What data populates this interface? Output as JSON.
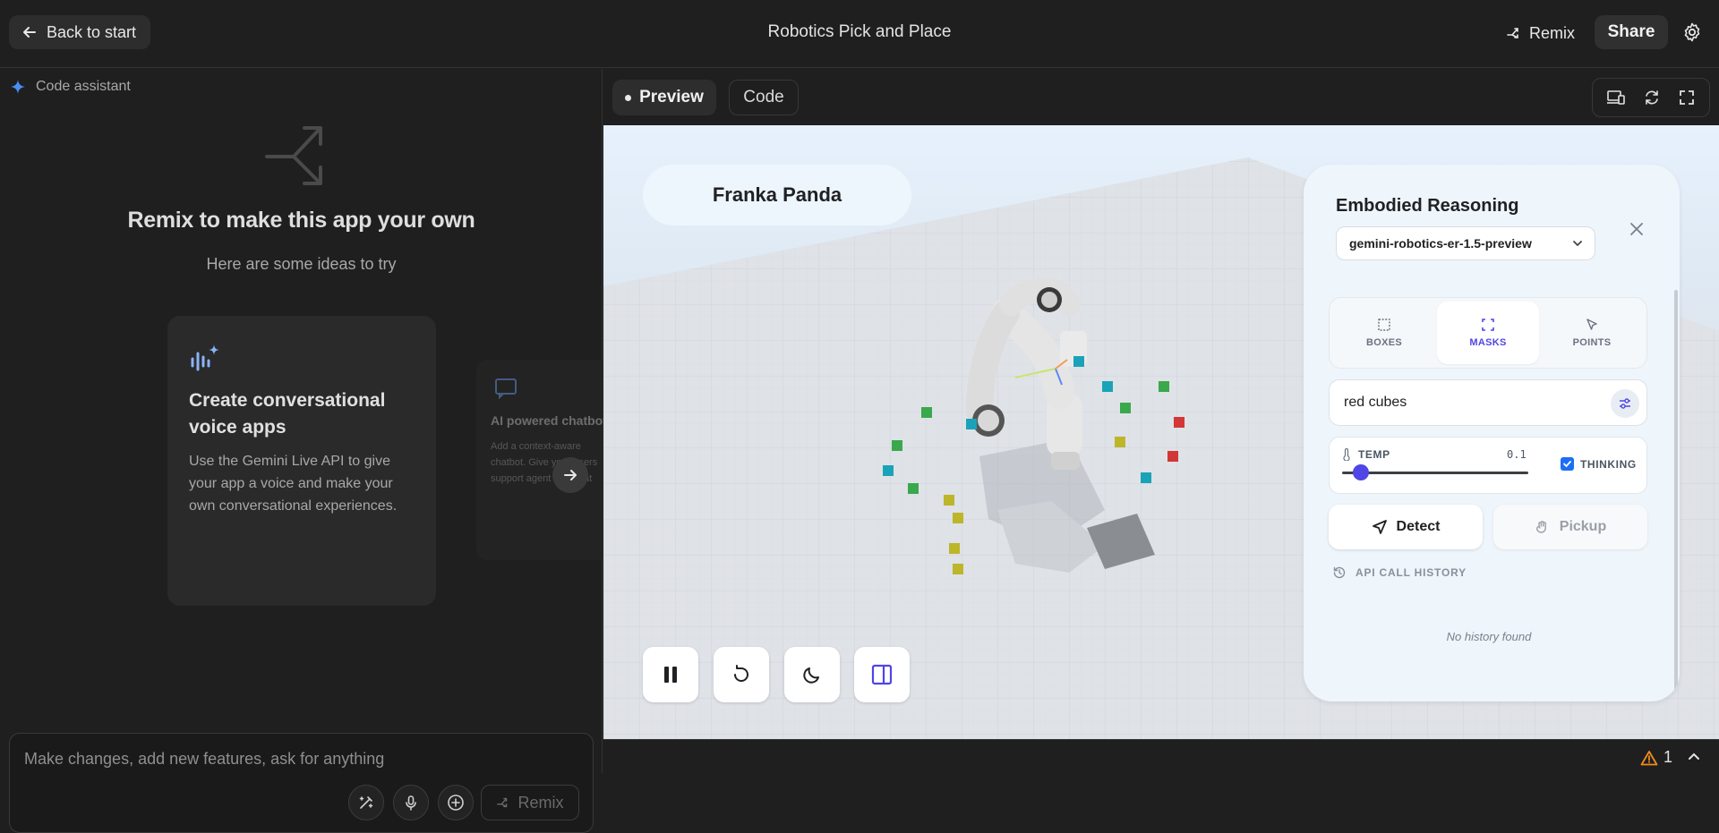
{
  "header": {
    "back_label": "Back to start",
    "app_title": "Robotics Pick and Place",
    "remix_label": "Remix",
    "share_label": "Share"
  },
  "left_panel": {
    "assistant_label": "Code assistant",
    "heading": "Remix to make this app your own",
    "subheading": "Here are some ideas to try",
    "cards": [
      {
        "title": "Create conversational voice apps",
        "description": "Use the Gemini Live API to give your app a voice and make your own conversational experiences."
      },
      {
        "title": "AI powered chatbot",
        "description": "Add a context-aware chatbot. Give your users support agent or a chat"
      }
    ],
    "prompt_placeholder": "Make changes, add new features, ask for anything",
    "remix_button_label": "Remix"
  },
  "tabs": {
    "preview_label": "Preview",
    "code_label": "Code"
  },
  "viewport": {
    "robot_name": "Franka Panda"
  },
  "er_panel": {
    "title": "Embodied Reasoning",
    "model": "gemini-robotics-er-1.5-preview",
    "modes": [
      {
        "label": "BOXES",
        "icon": "boxes-icon"
      },
      {
        "label": "MASKS",
        "icon": "masks-icon",
        "active": true
      },
      {
        "label": "POINTS",
        "icon": "points-icon"
      }
    ],
    "query_value": "red cubes",
    "temp_label": "TEMP",
    "temp_value": "0.1",
    "temp_fraction": 0.1,
    "thinking_label": "THINKING",
    "thinking_checked": true,
    "detect_label": "Detect",
    "pickup_label": "Pickup",
    "history_title": "API CALL HISTORY",
    "no_history": "No history found"
  },
  "status": {
    "warning_count": "1"
  },
  "colors": {
    "accent": "#4f46e5",
    "checkbox": "#1d6ef5",
    "warning": "#f28b20"
  }
}
